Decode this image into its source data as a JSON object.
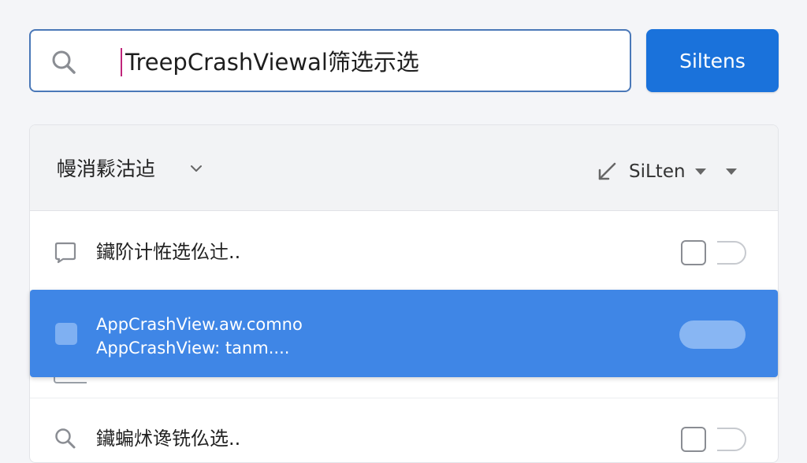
{
  "search": {
    "value": "TreepCrashViewal筛选示选",
    "icon": "search-icon"
  },
  "primary_button": {
    "label": "Siltens"
  },
  "list_header": {
    "title": "幔消鬏沽迠",
    "sort_label": "SiLten",
    "icons": [
      "chevron-down-icon",
      "sort-arrow-icon",
      "caret-down-icon"
    ]
  },
  "rows": [
    {
      "text": "鑶阶计恠选仫辻..",
      "icon": "checkbox-icon",
      "selected": false
    },
    {
      "line1": "AppCrashView.aw.comno",
      "line2": "AppCrashView: tanm....",
      "selected": true
    },
    {
      "text": "鑶蝙炢谗铣仫选..",
      "icon": "search-icon",
      "selected": false
    }
  ],
  "colors": {
    "accent": "#1a72db",
    "selected_row": "#3f86e6",
    "search_border": "#4a78b8"
  }
}
